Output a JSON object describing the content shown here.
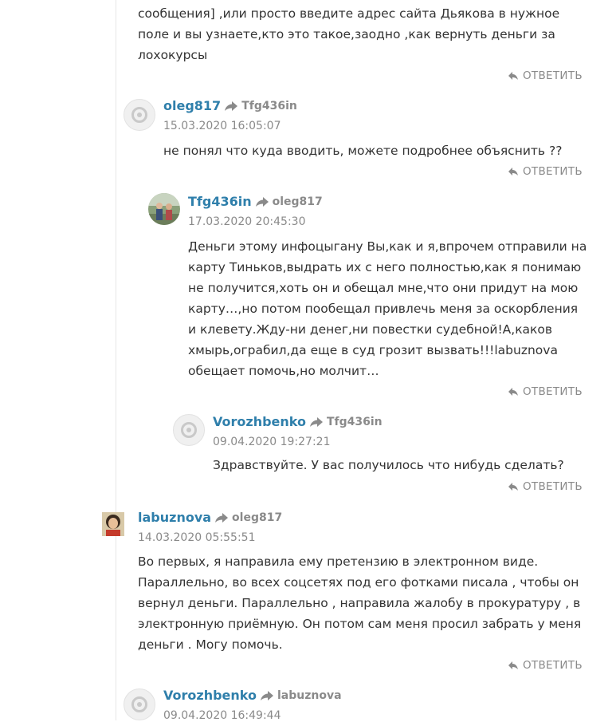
{
  "reply_label": "ОТВЕТИТЬ",
  "top_comment": {
    "lines": [
      "сообщения] ,или просто введите адрес сайта Дьякова в нужное",
      "поле и вы узнаете,кто это такое,заодно ,как вернуть деньги за",
      "лохокурсы"
    ]
  },
  "comments": [
    {
      "author": "oleg817",
      "reply_to": "Tfg436in",
      "date": "15.03.2020 16:05:07",
      "lines": [
        "не понял что куда вводить, можете подробнее объяснить ??"
      ]
    },
    {
      "author": "Tfg436in",
      "reply_to": "oleg817",
      "date": "17.03.2020 20:45:30",
      "lines": [
        "Деньги этому инфоцыгану Вы,как и я,впрочем отправили на",
        "карту Тиньков,выдрать их с него полностью,как я понимаю",
        "не получится,хоть он и обещал мне,что они придут на мою",
        "карту…,но потом пообещал привлечь меня за оскорбления",
        "и клевету.Жду-ни денег,ни повестки судебной!А,каков",
        "хмырь,ограбил,да еще в суд грозит вызвать!!!labuznova",
        "обещает помочь,но молчит…"
      ]
    },
    {
      "author": "Vorozhbenko",
      "reply_to": "Tfg436in",
      "date": "09.04.2020 19:27:21",
      "lines": [
        "Здравствуйте. У вас получилось что нибудь сделать?"
      ]
    },
    {
      "author": "labuznova",
      "reply_to": "oleg817",
      "date": "14.03.2020 05:55:51",
      "lines": [
        "Во первых, я направила ему претензию в электронном виде.",
        "Параллельно, во всех соцсетях под его фотками писала , чтобы он",
        "вернул деньги. Параллельно , направила жалобу в прокуратуру , в",
        "электронную приёмную. Он потом сам меня просил забрать у меня",
        "деньги . Могу помочь."
      ]
    },
    {
      "author": "Vorozhbenko",
      "reply_to": "labuznova",
      "date": "09.04.2020 16:49:44",
      "lines": []
    }
  ]
}
